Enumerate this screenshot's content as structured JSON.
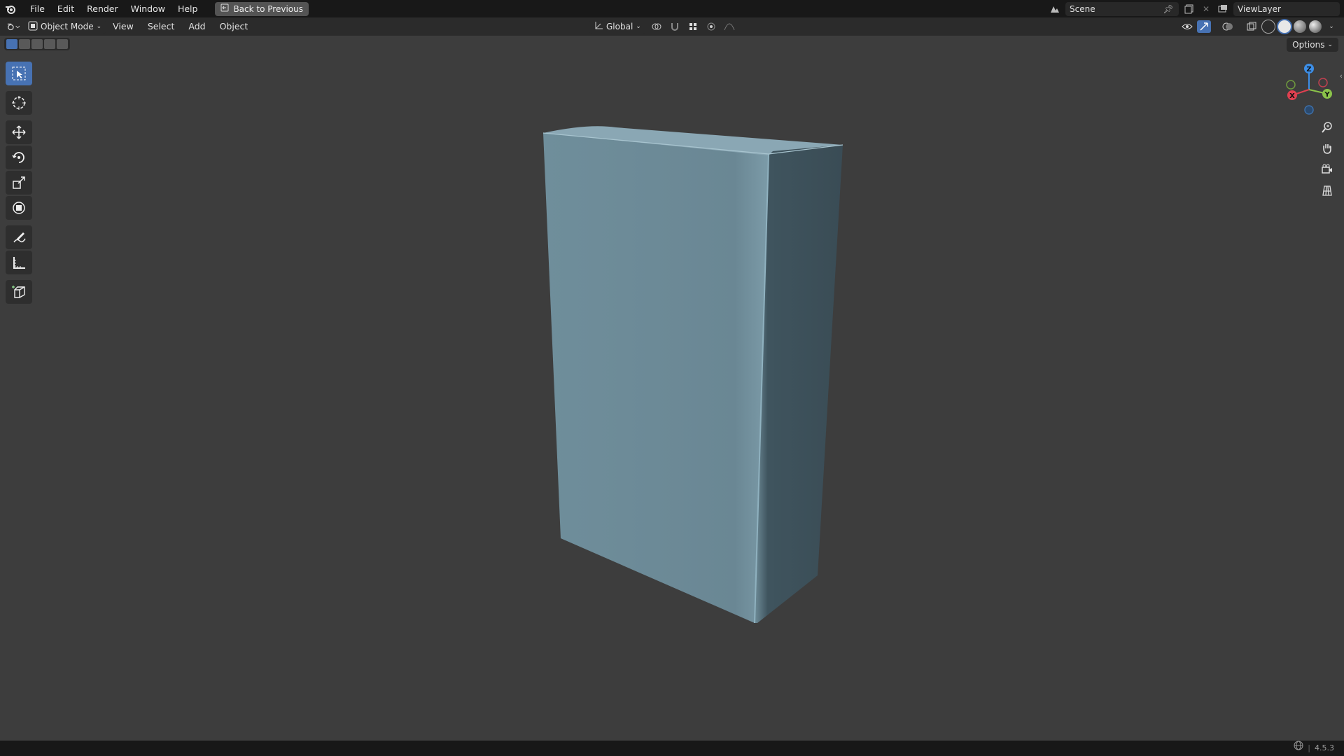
{
  "topbar": {
    "menu": [
      "File",
      "Edit",
      "Render",
      "Window",
      "Help"
    ],
    "back_label": "Back to Previous",
    "scene": "Scene",
    "view_layer": "ViewLayer"
  },
  "header": {
    "mode": "Object Mode",
    "menus": [
      "View",
      "Select",
      "Add",
      "Object"
    ],
    "orientation": "Global"
  },
  "viewport": {
    "options_label": "Options",
    "gizmo": {
      "x": "X",
      "y": "Y",
      "z": "Z"
    },
    "object_color": "#6b8793"
  },
  "status": {
    "version": "4.5.3"
  },
  "colors": {
    "accent": "#4772b3",
    "axis_x": "#e04050",
    "axis_y": "#8bc34a",
    "axis_z": "#3d8fe8"
  }
}
